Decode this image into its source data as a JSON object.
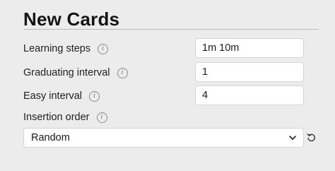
{
  "section": {
    "title": "New Cards"
  },
  "fields": [
    {
      "label": "Learning steps",
      "value": "1m 10m",
      "icon": "info-icon"
    },
    {
      "label": "Graduating interval",
      "value": "1",
      "icon": "info-icon"
    },
    {
      "label": "Easy interval",
      "value": "4",
      "icon": "info-icon"
    }
  ],
  "insertion_order": {
    "label": "Insertion order",
    "icon": "info-icon",
    "selected": "Random",
    "dropdown_icon": "chevron-down-icon",
    "reset_icon": "revert-icon"
  },
  "colors": {
    "background": "#ececec",
    "input_background": "#ffffff",
    "input_border": "#d4d4d4",
    "rule": "#b9b9b9"
  }
}
